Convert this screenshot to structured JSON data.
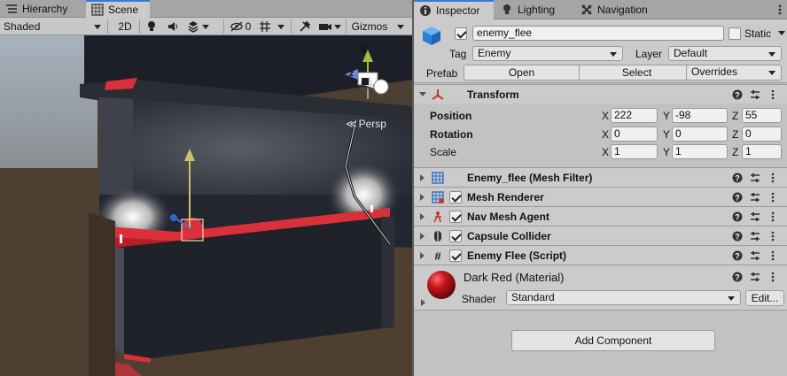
{
  "left_tabs": {
    "hierarchy": "Hierarchy",
    "scene": "Scene"
  },
  "scene_toolbar": {
    "shading_mode": "Shaded",
    "two_d": "2D",
    "hidden_count": "0",
    "gizmos": "Gizmos"
  },
  "viewport": {
    "gizmo_axis_y": "y",
    "gizmo_axis_z": "z",
    "projection": "Persp"
  },
  "right_tabs": {
    "inspector": "Inspector",
    "lighting": "Lighting",
    "navigation": "Navigation"
  },
  "object": {
    "name": "enemy_flee",
    "static_label": "Static",
    "tag_label": "Tag",
    "tag_value": "Enemy",
    "layer_label": "Layer",
    "layer_value": "Default",
    "prefab_label": "Prefab",
    "open_button": "Open",
    "select_button": "Select",
    "overrides_button": "Overrides"
  },
  "transform": {
    "title": "Transform",
    "rows": [
      {
        "label": "Position",
        "x": "222",
        "y": "-98",
        "z": "55"
      },
      {
        "label": "Rotation",
        "x": "0",
        "y": "0",
        "z": "0"
      },
      {
        "label": "Scale",
        "x": "1",
        "y": "1",
        "z": "1"
      }
    ],
    "axis_x": "X",
    "axis_y": "Y",
    "axis_z": "Z"
  },
  "components": [
    {
      "title": "Enemy_flee (Mesh Filter)",
      "icon": "mesh-filter-icon",
      "has_toggle": false
    },
    {
      "title": "Mesh Renderer",
      "icon": "mesh-renderer-icon",
      "has_toggle": true
    },
    {
      "title": "Nav Mesh Agent",
      "icon": "nav-mesh-agent-icon",
      "has_toggle": true
    },
    {
      "title": "Capsule Collider",
      "icon": "capsule-collider-icon",
      "has_toggle": true
    },
    {
      "title": "Enemy Flee (Script)",
      "icon": "script-icon",
      "has_toggle": true
    }
  ],
  "material": {
    "name": "Dark Red (Material)",
    "shader_label": "Shader",
    "shader_value": "Standard",
    "edit_button": "Edit..."
  },
  "add_component_button": "Add Component",
  "colors": {
    "accent_tab": "#3a79d8",
    "material_red": "#c4161c",
    "scene_red": "#d9303a"
  }
}
